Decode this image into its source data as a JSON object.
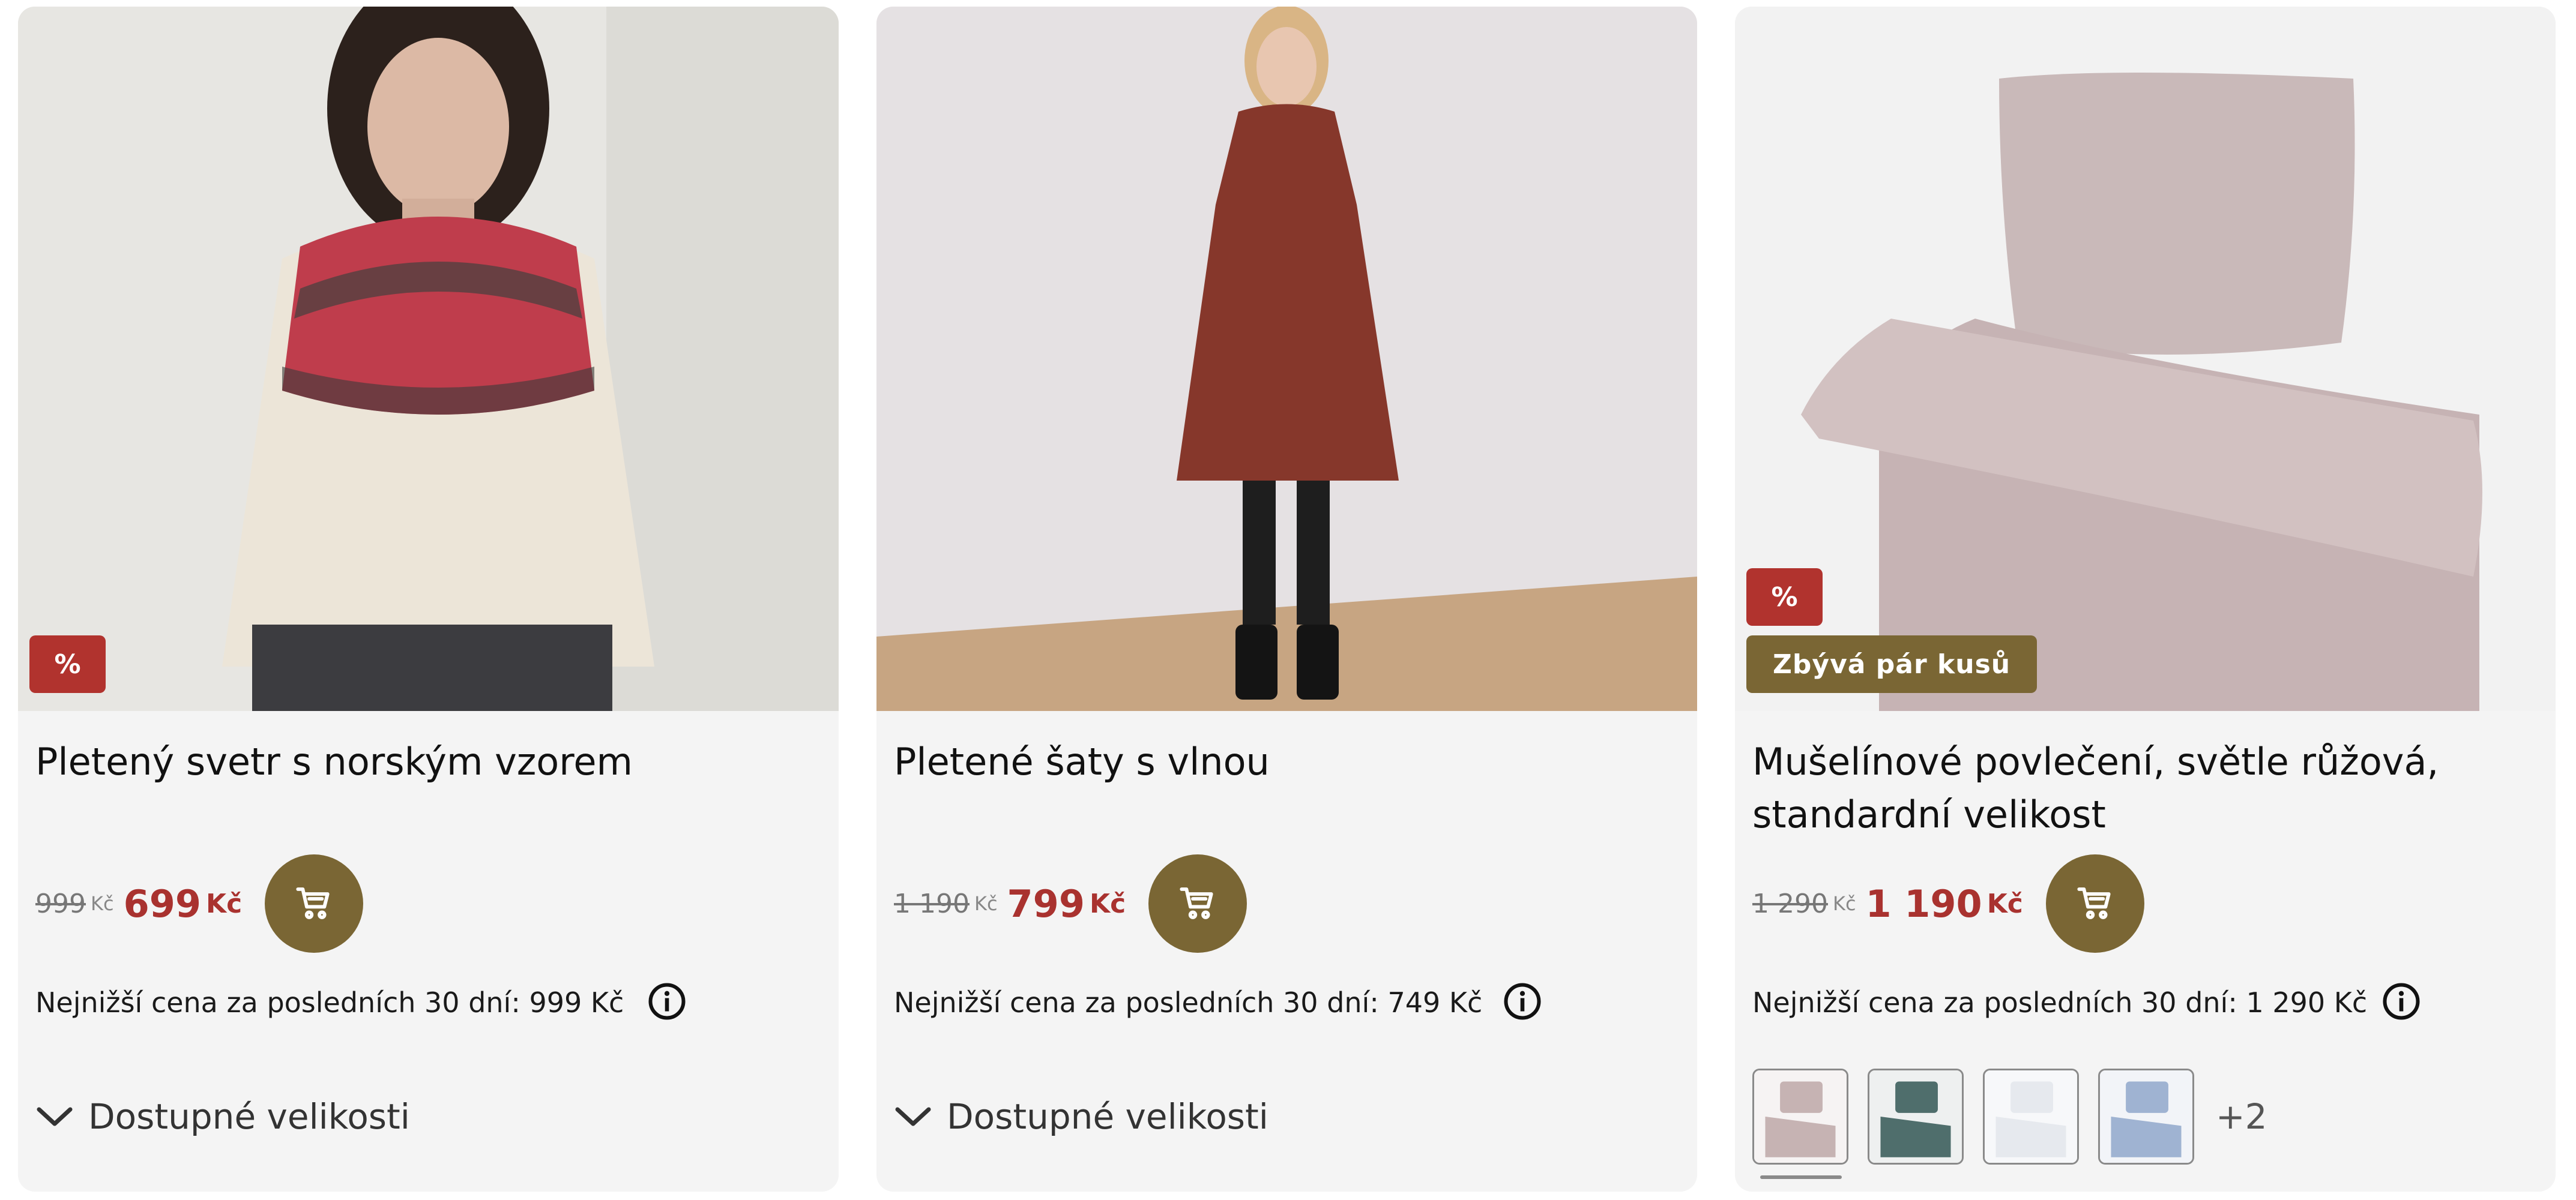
{
  "products": [
    {
      "title": "Pletený svetr s norským vzorem",
      "old_price": "999",
      "old_currency": "Kč",
      "new_price": "699",
      "new_currency": "Kč",
      "discount_badge": "%",
      "lowest_price_label": "Nejnižší cena za posledních 30 dní: 999 Kč",
      "sizes_label": "Dostupné velikosti"
    },
    {
      "title": "Pletené šaty s vlnou",
      "old_price": "1 190",
      "old_currency": "Kč",
      "new_price": "799",
      "new_currency": "Kč",
      "lowest_price_label": "Nejnižší cena za posledních 30 dní: 749 Kč",
      "sizes_label": "Dostupné velikosti"
    },
    {
      "title": "Mušelínové povlečení, světle růžová, standardní velikost",
      "old_price": "1 290",
      "old_currency": "Kč",
      "new_price": "1 190",
      "new_currency": "Kč",
      "discount_badge": "%",
      "stock_badge": "Zbývá pár kusů",
      "lowest_price_label": "Nejnižší cena za posledních 30 dní: 1 290 Kč",
      "more_colors": "+2",
      "swatches": [
        {
          "color": "#c6b3b3",
          "name": "light-pink"
        },
        {
          "color": "#4f6e6c",
          "name": "teal"
        },
        {
          "color": "#eef0f3",
          "name": "white"
        },
        {
          "color": "#9fb3d2",
          "name": "light-blue"
        }
      ]
    }
  ],
  "icons": {
    "cart": "shopping-cart-icon",
    "info": "info-icon",
    "chevron": "chevron-down-icon"
  },
  "colors": {
    "accent": "#7a6634",
    "sale": "#a9322f",
    "badge_red": "#b1332e",
    "card_bg": "#f4f4f4"
  }
}
